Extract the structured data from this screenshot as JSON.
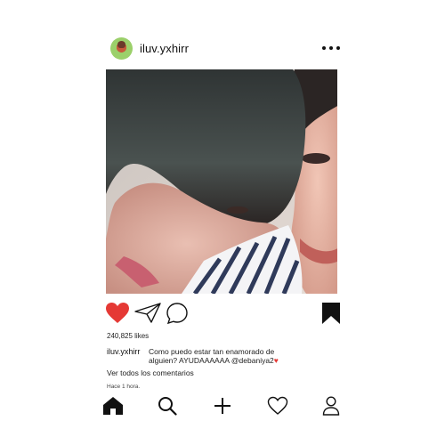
{
  "post": {
    "username": "iluv.yxhirr",
    "likes": "240,825 likes",
    "caption_user": "iluv.yxhirr",
    "caption_text": "Como puedo estar tan enamorado de alguien? AYUDAAAAAA  @debaniya2",
    "caption_heart": "♥",
    "view_comments": "Ver todos los comentarios",
    "time": "Hace 1 hora."
  },
  "header": {
    "avatar_icon": "avatar-icon",
    "more_icon": "more-options-icon"
  },
  "actions": {
    "like_icon": "heart-filled-icon",
    "share_icon": "paper-plane-icon",
    "comment_icon": "comment-bubble-icon",
    "save_icon": "bookmark-filled-icon",
    "like_color": "#e53935"
  },
  "nav": {
    "items": [
      "home-icon",
      "search-icon",
      "add-icon",
      "heart-outline-icon",
      "profile-icon"
    ]
  },
  "colors": {
    "accent": "#e53935",
    "text": "#111111",
    "background": "#ffffff"
  }
}
